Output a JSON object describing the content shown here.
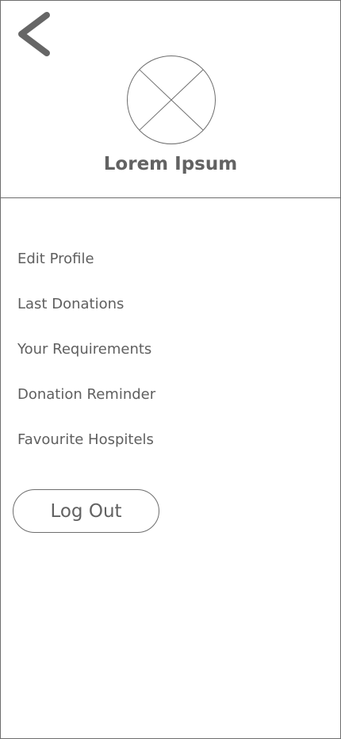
{
  "header": {
    "back_icon": "chevron-left-icon",
    "avatar_icon": "placeholder-avatar-icon",
    "user_name": "Lorem Ipsum"
  },
  "menu": {
    "items": [
      {
        "label": "Edit Profile"
      },
      {
        "label": "Last Donations"
      },
      {
        "label": "Your Requirements"
      },
      {
        "label": "Donation Reminder"
      },
      {
        "label": "Favourite Hospitels"
      }
    ]
  },
  "actions": {
    "logout_label": "Log Out"
  },
  "colors": {
    "text": "#5f5f5f",
    "border": "#6e6e6e",
    "background": "#ffffff"
  }
}
